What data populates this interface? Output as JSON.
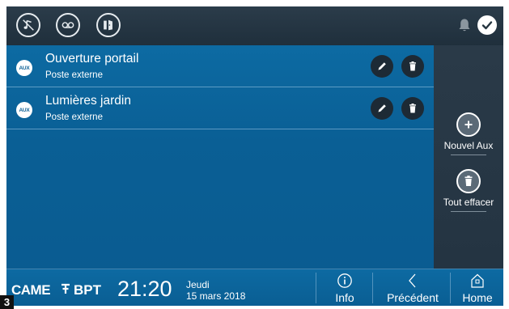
{
  "topbar": {
    "icons": [
      "music-mute-icon",
      "voicemail-icon",
      "door-icon"
    ],
    "bell_icon": "bell-icon",
    "check_icon": "check-icon"
  },
  "list": {
    "items": [
      {
        "title": "Ouverture portail",
        "subtitle": "Poste externe",
        "badge": "AUX"
      },
      {
        "title": "Lumières jardin",
        "subtitle": "Poste externe",
        "badge": "AUX"
      }
    ]
  },
  "side": {
    "add_label": "Nouvel Aux",
    "clear_label": "Tout effacer"
  },
  "bottom": {
    "brand_came": "CAME",
    "brand_bpt": "BPT",
    "time": "21:20",
    "day": "Jeudi",
    "date": "15 mars 2018",
    "info_label": "Info",
    "back_label": "Précédent",
    "home_label": "Home"
  },
  "page_number": "3",
  "colors": {
    "screen_bg": "#0b6199",
    "topbar_bg": "#24343f",
    "panel_bg": "#263745",
    "button_dark": "#1d2a35"
  }
}
